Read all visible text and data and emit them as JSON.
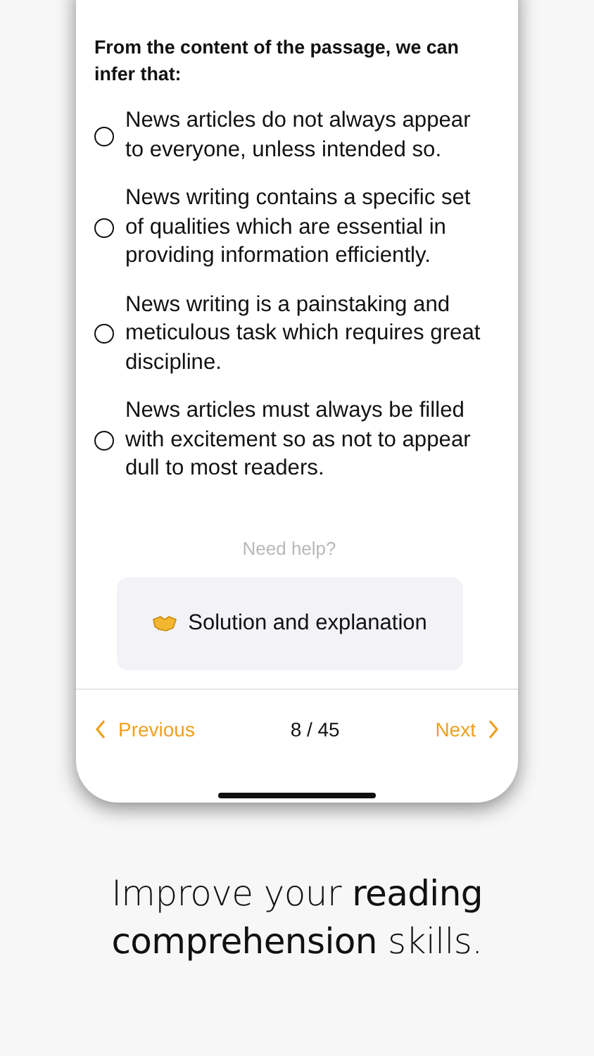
{
  "question": "From the content of the passage, we can infer that:",
  "options": [
    {
      "text": "News articles do not always appear to everyone, unless intended so.",
      "selected": false
    },
    {
      "text": "News writing contains a specific set of qualities which are essential in providing information efficiently.",
      "selected": false
    },
    {
      "text": "News writing is a painstaking and meticulous task which requires great discipline.",
      "selected": false
    },
    {
      "text": "News articles must always be filled with excitement so as not to appear dull to most readers.",
      "selected": false
    }
  ],
  "help_label": "Need help?",
  "solution_button": "Solution and explanation",
  "nav": {
    "previous": "Previous",
    "counter": "8 / 45",
    "next": "Next"
  },
  "caption": "Improve your **reading** **comprehension** skills."
}
